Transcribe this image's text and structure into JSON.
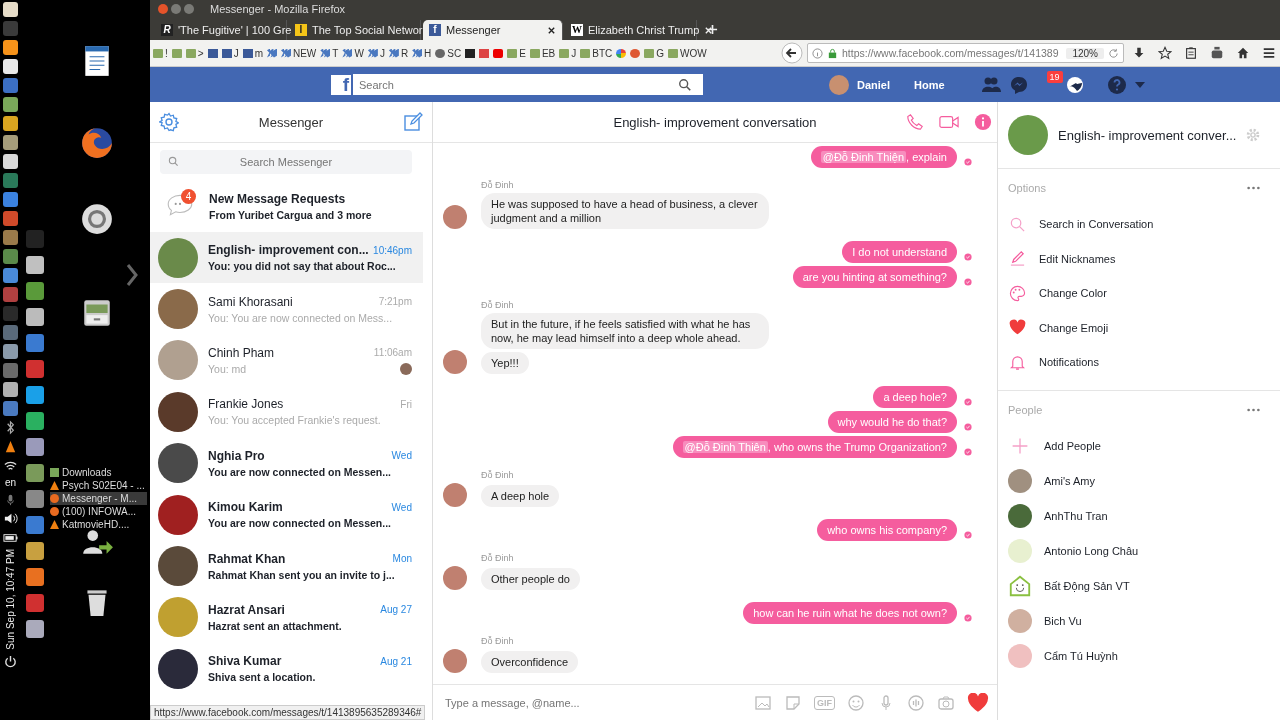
{
  "desktop": {
    "keyboard": "en",
    "clock": "Sun Sep 10, 10:47 PM",
    "windows": [
      {
        "kind": "folder",
        "label": "Downloads",
        "selected": false
      },
      {
        "kind": "vlc",
        "label": "Psych S02E04 - ...",
        "selected": false
      },
      {
        "kind": "firefox",
        "label": "Messenger - M...",
        "selected": true
      },
      {
        "kind": "firefox",
        "label": "(100) INFOWA...",
        "selected": false
      },
      {
        "kind": "vlc",
        "label": "KatmovieHD....",
        "selected": false
      }
    ]
  },
  "window": {
    "title": "Messenger - Mozilla Firefox"
  },
  "tabs": [
    {
      "icon_letter": "R",
      "kind": "r",
      "label": "'The Fugitive' | 100 Gre",
      "selected": false
    },
    {
      "icon_letter": "l",
      "kind": "l",
      "label": "The Top Social Networ",
      "selected": false
    },
    {
      "icon_letter": "f",
      "kind": "f",
      "label": "Messenger",
      "selected": true
    },
    {
      "icon_letter": "W",
      "kind": "w",
      "label": "Elizabeth Christ Trump",
      "selected": false
    }
  ],
  "bookmarks": [
    {
      "kind": "folder",
      "label": "!"
    },
    {
      "kind": "folder"
    },
    {
      "kind": "folder",
      "label": ">"
    },
    {
      "kind": "fb"
    },
    {
      "kind": "fb",
      "label": "J"
    },
    {
      "kind": "fb",
      "label": "m"
    },
    {
      "kind": "steem"
    },
    {
      "kind": "steem",
      "label": "NEW"
    },
    {
      "kind": "steem",
      "label": "T"
    },
    {
      "kind": "steem",
      "label": "W"
    },
    {
      "kind": "steem",
      "label": "J"
    },
    {
      "kind": "steem",
      "label": "R"
    },
    {
      "kind": "steem",
      "label": "H"
    },
    {
      "kind": "globe",
      "label": "SC"
    },
    {
      "kind": "printer"
    },
    {
      "kind": "gmail"
    },
    {
      "kind": "youtube"
    },
    {
      "kind": "folder",
      "label": "E"
    },
    {
      "kind": "folder",
      "label": "EB"
    },
    {
      "kind": "folder",
      "label": "J"
    },
    {
      "kind": "folder",
      "label": "BTC"
    },
    {
      "kind": "google"
    },
    {
      "kind": "ddg"
    },
    {
      "kind": "folder",
      "label": "G"
    },
    {
      "kind": "folder",
      "label": "WOW"
    }
  ],
  "address_bar": {
    "url": "https://www.facebook.com/messages/t/141389",
    "zoom": "120%"
  },
  "facebook_bar": {
    "logo": "f",
    "search_placeholder": "Search",
    "user": "Daniel",
    "home": "Home",
    "notification_count": "19"
  },
  "messenger": {
    "title": "Messenger",
    "search_placeholder": "Search Messenger",
    "requests": {
      "title": "New Message Requests",
      "subtitle": "From Yuribet Cargua and 3 more",
      "count": "4"
    },
    "conversations": [
      {
        "name": "English- improvement con...",
        "time": "10:46pm",
        "preview": "You: you did not say that about Roc...",
        "unread": true,
        "selected": true,
        "seen_avatar": false
      },
      {
        "name": "Sami Khorasani",
        "time": "7:21pm",
        "preview": "You: You are now connected on Mess...",
        "unread": false,
        "selected": false,
        "seen_avatar": false
      },
      {
        "name": "Chinh Pham",
        "time": "11:06am",
        "preview": "You: md",
        "unread": false,
        "selected": false,
        "seen_avatar": true
      },
      {
        "name": "Frankie Jones",
        "time": "Fri",
        "preview": "You: You accepted Frankie's request.",
        "unread": false,
        "selected": false,
        "seen_avatar": false
      },
      {
        "name": "Nghia Pro",
        "time": "Wed",
        "preview": "You are now connected on Messen...",
        "unread": true,
        "selected": false,
        "seen_avatar": false
      },
      {
        "name": "Kimou Karim",
        "time": "Wed",
        "preview": "You are now connected on Messen...",
        "unread": true,
        "selected": false,
        "seen_avatar": false
      },
      {
        "name": "Rahmat Khan",
        "time": "Mon",
        "preview": "Rahmat Khan sent you an invite to j...",
        "unread": true,
        "selected": false,
        "seen_avatar": false
      },
      {
        "name": "Hazrat Ansari",
        "time": "Aug 27",
        "preview": "Hazrat sent an attachment.",
        "unread": true,
        "selected": false,
        "seen_avatar": false
      },
      {
        "name": "Shiva Kumar",
        "time": "Aug 21",
        "preview": "Shiva sent a location.",
        "unread": true,
        "selected": false,
        "seen_avatar": false
      }
    ]
  },
  "chat": {
    "title": "English- improvement conversation",
    "messages": [
      {
        "kind": "sent",
        "items": [
          {
            "mention": "@Đỗ Đinh Thiện",
            "text": ", explain"
          }
        ]
      },
      {
        "kind": "received",
        "sender": "Đỗ Đinh",
        "items": [
          {
            "text": "He was supposed to have a head of business, a clever judgment and a million"
          }
        ]
      },
      {
        "kind": "sent",
        "items": [
          {
            "text": "I do not understand"
          },
          {
            "text": "are you hinting at something?"
          }
        ]
      },
      {
        "kind": "received",
        "sender": "Đỗ Đinh",
        "items": [
          {
            "text": "But in the future, if he feels satisfied with what he has now, he may lead himself into a deep whole ahead."
          },
          {
            "text": "Yep!!!"
          }
        ]
      },
      {
        "kind": "sent",
        "items": [
          {
            "text": "a deep hole?"
          },
          {
            "text": "why would he do that?"
          },
          {
            "mention": "@Đỗ Đinh Thiên",
            "text": ", who owns the Trump Organization?"
          }
        ]
      },
      {
        "kind": "received",
        "sender": "Đỗ Đinh",
        "items": [
          {
            "text": "A deep hole"
          }
        ]
      },
      {
        "kind": "sent",
        "items": [
          {
            "text": "who owns his company?"
          }
        ]
      },
      {
        "kind": "received",
        "sender": "Đỗ Đinh",
        "items": [
          {
            "text": "Other people do"
          }
        ]
      },
      {
        "kind": "sent",
        "items": [
          {
            "text": "how can he ruin what he does not own?"
          }
        ]
      },
      {
        "kind": "received",
        "sender": "Đỗ Đinh",
        "items": [
          {
            "text": "Overconfidence"
          }
        ]
      }
    ],
    "composer": {
      "placeholder": "Type a message, @name...",
      "gif_label": "GIF"
    }
  },
  "details": {
    "title": "English- improvement conver...",
    "options_heading": "Options",
    "options": [
      {
        "kind": "search",
        "label": "Search in Conversation"
      },
      {
        "kind": "pencil",
        "label": "Edit Nicknames"
      },
      {
        "kind": "palette",
        "label": "Change Color"
      },
      {
        "kind": "heart",
        "label": "Change Emoji"
      },
      {
        "kind": "bell",
        "label": "Notifications"
      }
    ],
    "people_heading": "People",
    "people": [
      {
        "kind": "add",
        "name": "Add People"
      },
      {
        "kind": "person",
        "name": "Ami's Amy"
      },
      {
        "kind": "person",
        "name": "AnhThu Tran"
      },
      {
        "kind": "person",
        "name": "Antonio Long Châu"
      },
      {
        "kind": "page",
        "name": "Bất Động Sản VT"
      },
      {
        "kind": "person",
        "name": "Bich Vu"
      },
      {
        "kind": "person",
        "name": "Cẩm Tú Huỳnh"
      }
    ]
  },
  "status_url": "https://www.facebook.com/messages/t/1413895635289346#"
}
